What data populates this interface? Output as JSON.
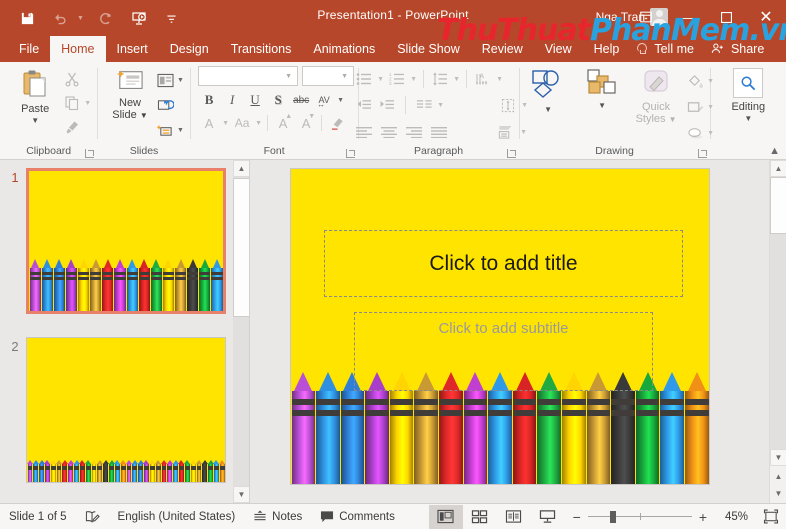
{
  "theme": {
    "titlebar_color": "#b7472a",
    "ribbon_bg": "#f7f6f5",
    "slide_bg": "#ffe400",
    "selection_color": "#e8806a"
  },
  "titlebar": {
    "document_title": "Presentation1  -  PowerPoint",
    "account_name": "Nga Tran",
    "quick_access": [
      {
        "name": "save-button",
        "label": "Save"
      },
      {
        "name": "undo-button",
        "label": "Undo"
      },
      {
        "name": "redo-button",
        "label": "Redo"
      },
      {
        "name": "start-presentation-button",
        "label": "Start From Beginning"
      },
      {
        "name": "customize-qat-button",
        "label": "Customize Quick Access Toolbar"
      }
    ],
    "window_controls": {
      "minimize": "—",
      "restore": "❐",
      "close": "✕",
      "ribbon_display": "ribbon-display-options"
    }
  },
  "watermark": {
    "part1": "Thu",
    "part2": "Thuat",
    "part3": "PhanMem",
    "part4": ".vn"
  },
  "tabs": [
    {
      "label": "File",
      "active": false
    },
    {
      "label": "Home",
      "active": true
    },
    {
      "label": "Insert",
      "active": false
    },
    {
      "label": "Design",
      "active": false
    },
    {
      "label": "Transitions",
      "active": false
    },
    {
      "label": "Animations",
      "active": false
    },
    {
      "label": "Slide Show",
      "active": false
    },
    {
      "label": "Review",
      "active": false
    },
    {
      "label": "View",
      "active": false
    },
    {
      "label": "Help",
      "active": false
    },
    {
      "label": "Tell me",
      "active": false
    },
    {
      "label": "Share",
      "active": false
    }
  ],
  "ribbon": {
    "groups": {
      "clipboard": {
        "label": "Clipboard",
        "paste_label": "Paste",
        "cut_label": "Cut",
        "copy_label": "Copy",
        "format_painter_label": "Format Painter"
      },
      "slides": {
        "label": "Slides",
        "new_slide_label": "New\nSlide",
        "new_slide_line1": "New",
        "new_slide_line2": "Slide",
        "layout_label": "Layout",
        "reset_label": "Reset",
        "section_label": "Section"
      },
      "font": {
        "label": "Font",
        "font_name_value": "",
        "font_size_value": "",
        "bold_label": "B",
        "italic_label": "I",
        "underline_label": "U",
        "shadow_label": "S",
        "strikethrough_label": "abc",
        "char_spacing_label": "AV",
        "font_color_label": "A",
        "change_case_label": "Aa",
        "increase_size_label": "A",
        "decrease_size_label": "A",
        "clear_formatting_label": "Clear All Formatting"
      },
      "paragraph": {
        "label": "Paragraph",
        "bullets_label": "Bullets",
        "numbering_label": "Numbering",
        "line_spacing_label": "Line Spacing",
        "text_direction_label": "Text Direction",
        "decrease_indent_label": "Decrease List Level",
        "increase_indent_label": "Increase List Level",
        "columns_label": "Columns",
        "align_text_label": "Align Text",
        "align_left_label": "Align Left",
        "center_label": "Center",
        "align_right_label": "Align Right",
        "justify_label": "Justify",
        "smartart_label": "Convert to SmartArt"
      },
      "drawing": {
        "label": "Drawing",
        "shapes_label": "Shapes",
        "arrange_label": "Arrange",
        "quick_styles_line1": "Quick",
        "quick_styles_line2": "Styles",
        "shape_fill_label": "Shape Fill",
        "shape_outline_label": "Shape Outline",
        "shape_effects_label": "Shape Effects"
      },
      "editing": {
        "label": "Editing",
        "editing_label": "Editing",
        "find_label": "Find"
      }
    },
    "collapse_label": "Collapse the Ribbon"
  },
  "thumbnails": [
    {
      "number": "1",
      "selected": true,
      "crayon_count": 16,
      "dense": false
    },
    {
      "number": "2",
      "selected": false,
      "crayon_count": 34,
      "dense": true
    }
  ],
  "slide": {
    "title_placeholder": "Click to add title",
    "subtitle_placeholder": "Click to add subtitle",
    "background_color": "#ffe400",
    "crayon_colors": [
      "#b84fd4",
      "#2f8fe0",
      "#2f7fd6",
      "#a93fc9",
      "#ffd400",
      "#c99a33",
      "#e02828",
      "#c13fd0",
      "#2f9ae8",
      "#d82424",
      "#1faa42",
      "#ffd400",
      "#c99a33",
      "#3a3a3a",
      "#18a83c",
      "#2f9ae8",
      "#f09016"
    ]
  },
  "statusbar": {
    "slide_counter": "Slide 1 of 5",
    "accessibility_label": "Accessibility Checker",
    "language": "English (United States)",
    "notes_label": "Notes",
    "comments_label": "Comments",
    "views": [
      {
        "name": "normal-view",
        "label": "Normal",
        "active": true
      },
      {
        "name": "slide-sorter-view",
        "label": "Slide Sorter",
        "active": false
      },
      {
        "name": "reading-view",
        "label": "Reading View",
        "active": false
      },
      {
        "name": "slide-show-view",
        "label": "Slide Show",
        "active": false
      }
    ],
    "zoom_out_label": "−",
    "zoom_in_label": "+",
    "zoom_percent": "45%",
    "fit_label": "Fit slide to current window"
  }
}
